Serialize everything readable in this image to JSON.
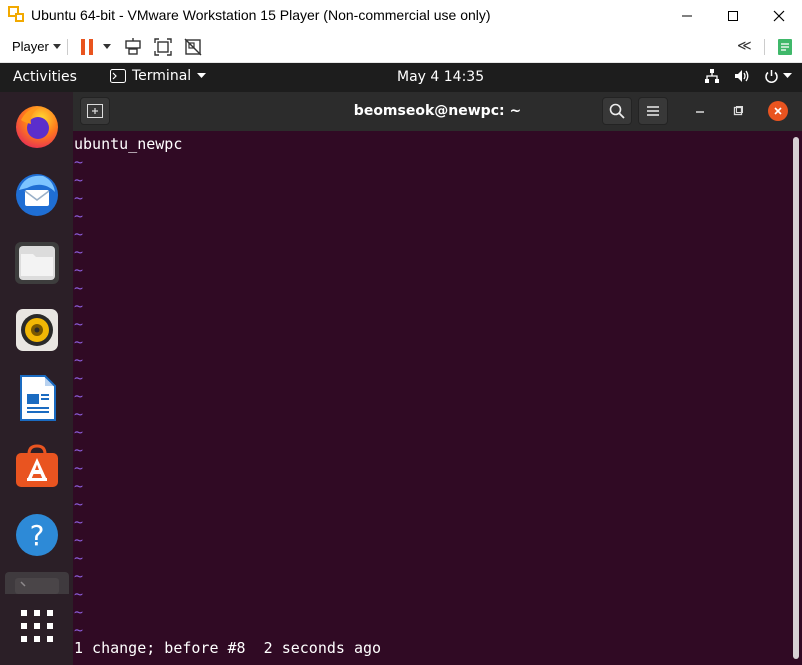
{
  "window": {
    "title": "Ubuntu 64-bit - VMware Workstation 15 Player (Non-commercial use only)",
    "minimize_glyph": "—",
    "maximize_glyph": "☐",
    "close_glyph": "✕"
  },
  "vmware_toolbar": {
    "player_label": "Player",
    "unity_glyph": "≪"
  },
  "gnome": {
    "activities": "Activities",
    "app_menu": "Terminal",
    "clock": "May 4  14:35"
  },
  "dock": {
    "items": [
      "Firefox",
      "Thunderbird",
      "Files",
      "Rhythmbox",
      "LibreOffice Writer",
      "Ubuntu Software",
      "Help",
      "Terminal",
      "Show Applications"
    ]
  },
  "terminal": {
    "title": "beomseok@newpc: ~",
    "first_line": "ubuntu_newpc",
    "tilde": "~",
    "tilde_count": 27,
    "status_line": "1 change; before #8  2 seconds ago"
  },
  "colors": {
    "terminal_bg": "#300a24",
    "tilde": "#8b5cd9",
    "header_bg": "#2c2c2c",
    "close_button": "#e95420",
    "gnome_bar": "#1d1d1d",
    "pause": "#e9541e"
  }
}
